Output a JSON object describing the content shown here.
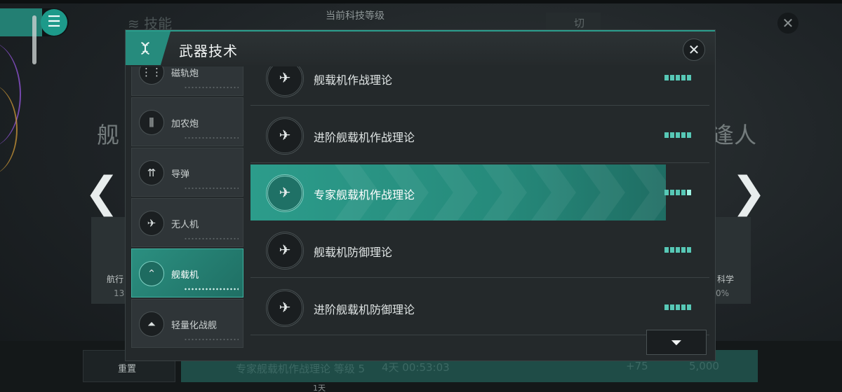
{
  "background": {
    "menu_icon": "list-icon",
    "skill_title": "技能",
    "tech_level_label": "当前科技等级",
    "switch_label": "切换",
    "close_icon": "close-icon",
    "left_big_text": "舰",
    "right_big_text": "逢人",
    "card_left_title": "航行",
    "card_left_value": "13",
    "card_right_title": "科学",
    "card_right_value": "0%",
    "bottom": {
      "reset_label": "重置",
      "research_text": "专家舰载机作战理论 等级 5",
      "timer_text": "4天 00:53:03",
      "plus_text": "+75",
      "cost_text": "5,000",
      "day_text": "1天"
    }
  },
  "modal": {
    "title": "武器技术",
    "close_icon": "close-icon",
    "categories": [
      {
        "label": "磁轨炮",
        "icon": "railgun-icon",
        "glyph": "⋮⋮",
        "active": false
      },
      {
        "label": "加农炮",
        "icon": "cannon-icon",
        "glyph": "⫼",
        "active": false
      },
      {
        "label": "导弹",
        "icon": "missile-icon",
        "glyph": "⇈",
        "active": false
      },
      {
        "label": "无人机",
        "icon": "drone-icon",
        "glyph": "✈",
        "active": false
      },
      {
        "label": "舰载机",
        "icon": "carrier-aircraft-icon",
        "glyph": "⌃",
        "active": true
      },
      {
        "label": "轻量化战舰",
        "icon": "light-warship-icon",
        "glyph": "⏶",
        "active": false
      }
    ],
    "techs": [
      {
        "name": "舰载机作战理论",
        "icon": "aircraft-icon",
        "glyph": "✈",
        "active": false
      },
      {
        "name": "进阶舰载机作战理论",
        "icon": "aircraft-icon",
        "glyph": "✈",
        "active": false
      },
      {
        "name": "专家舰载机作战理论",
        "icon": "aircraft-icon",
        "glyph": "✈",
        "active": true
      },
      {
        "name": "舰载机防御理论",
        "icon": "aircraft-icon",
        "glyph": "✈",
        "active": false
      },
      {
        "name": "进阶舰载机防御理论",
        "icon": "aircraft-icon",
        "glyph": "✈",
        "active": false
      }
    ],
    "filter_icon": "filter-icon",
    "accent_color": "#2a9d8c",
    "level_color": "#57c8b6"
  }
}
